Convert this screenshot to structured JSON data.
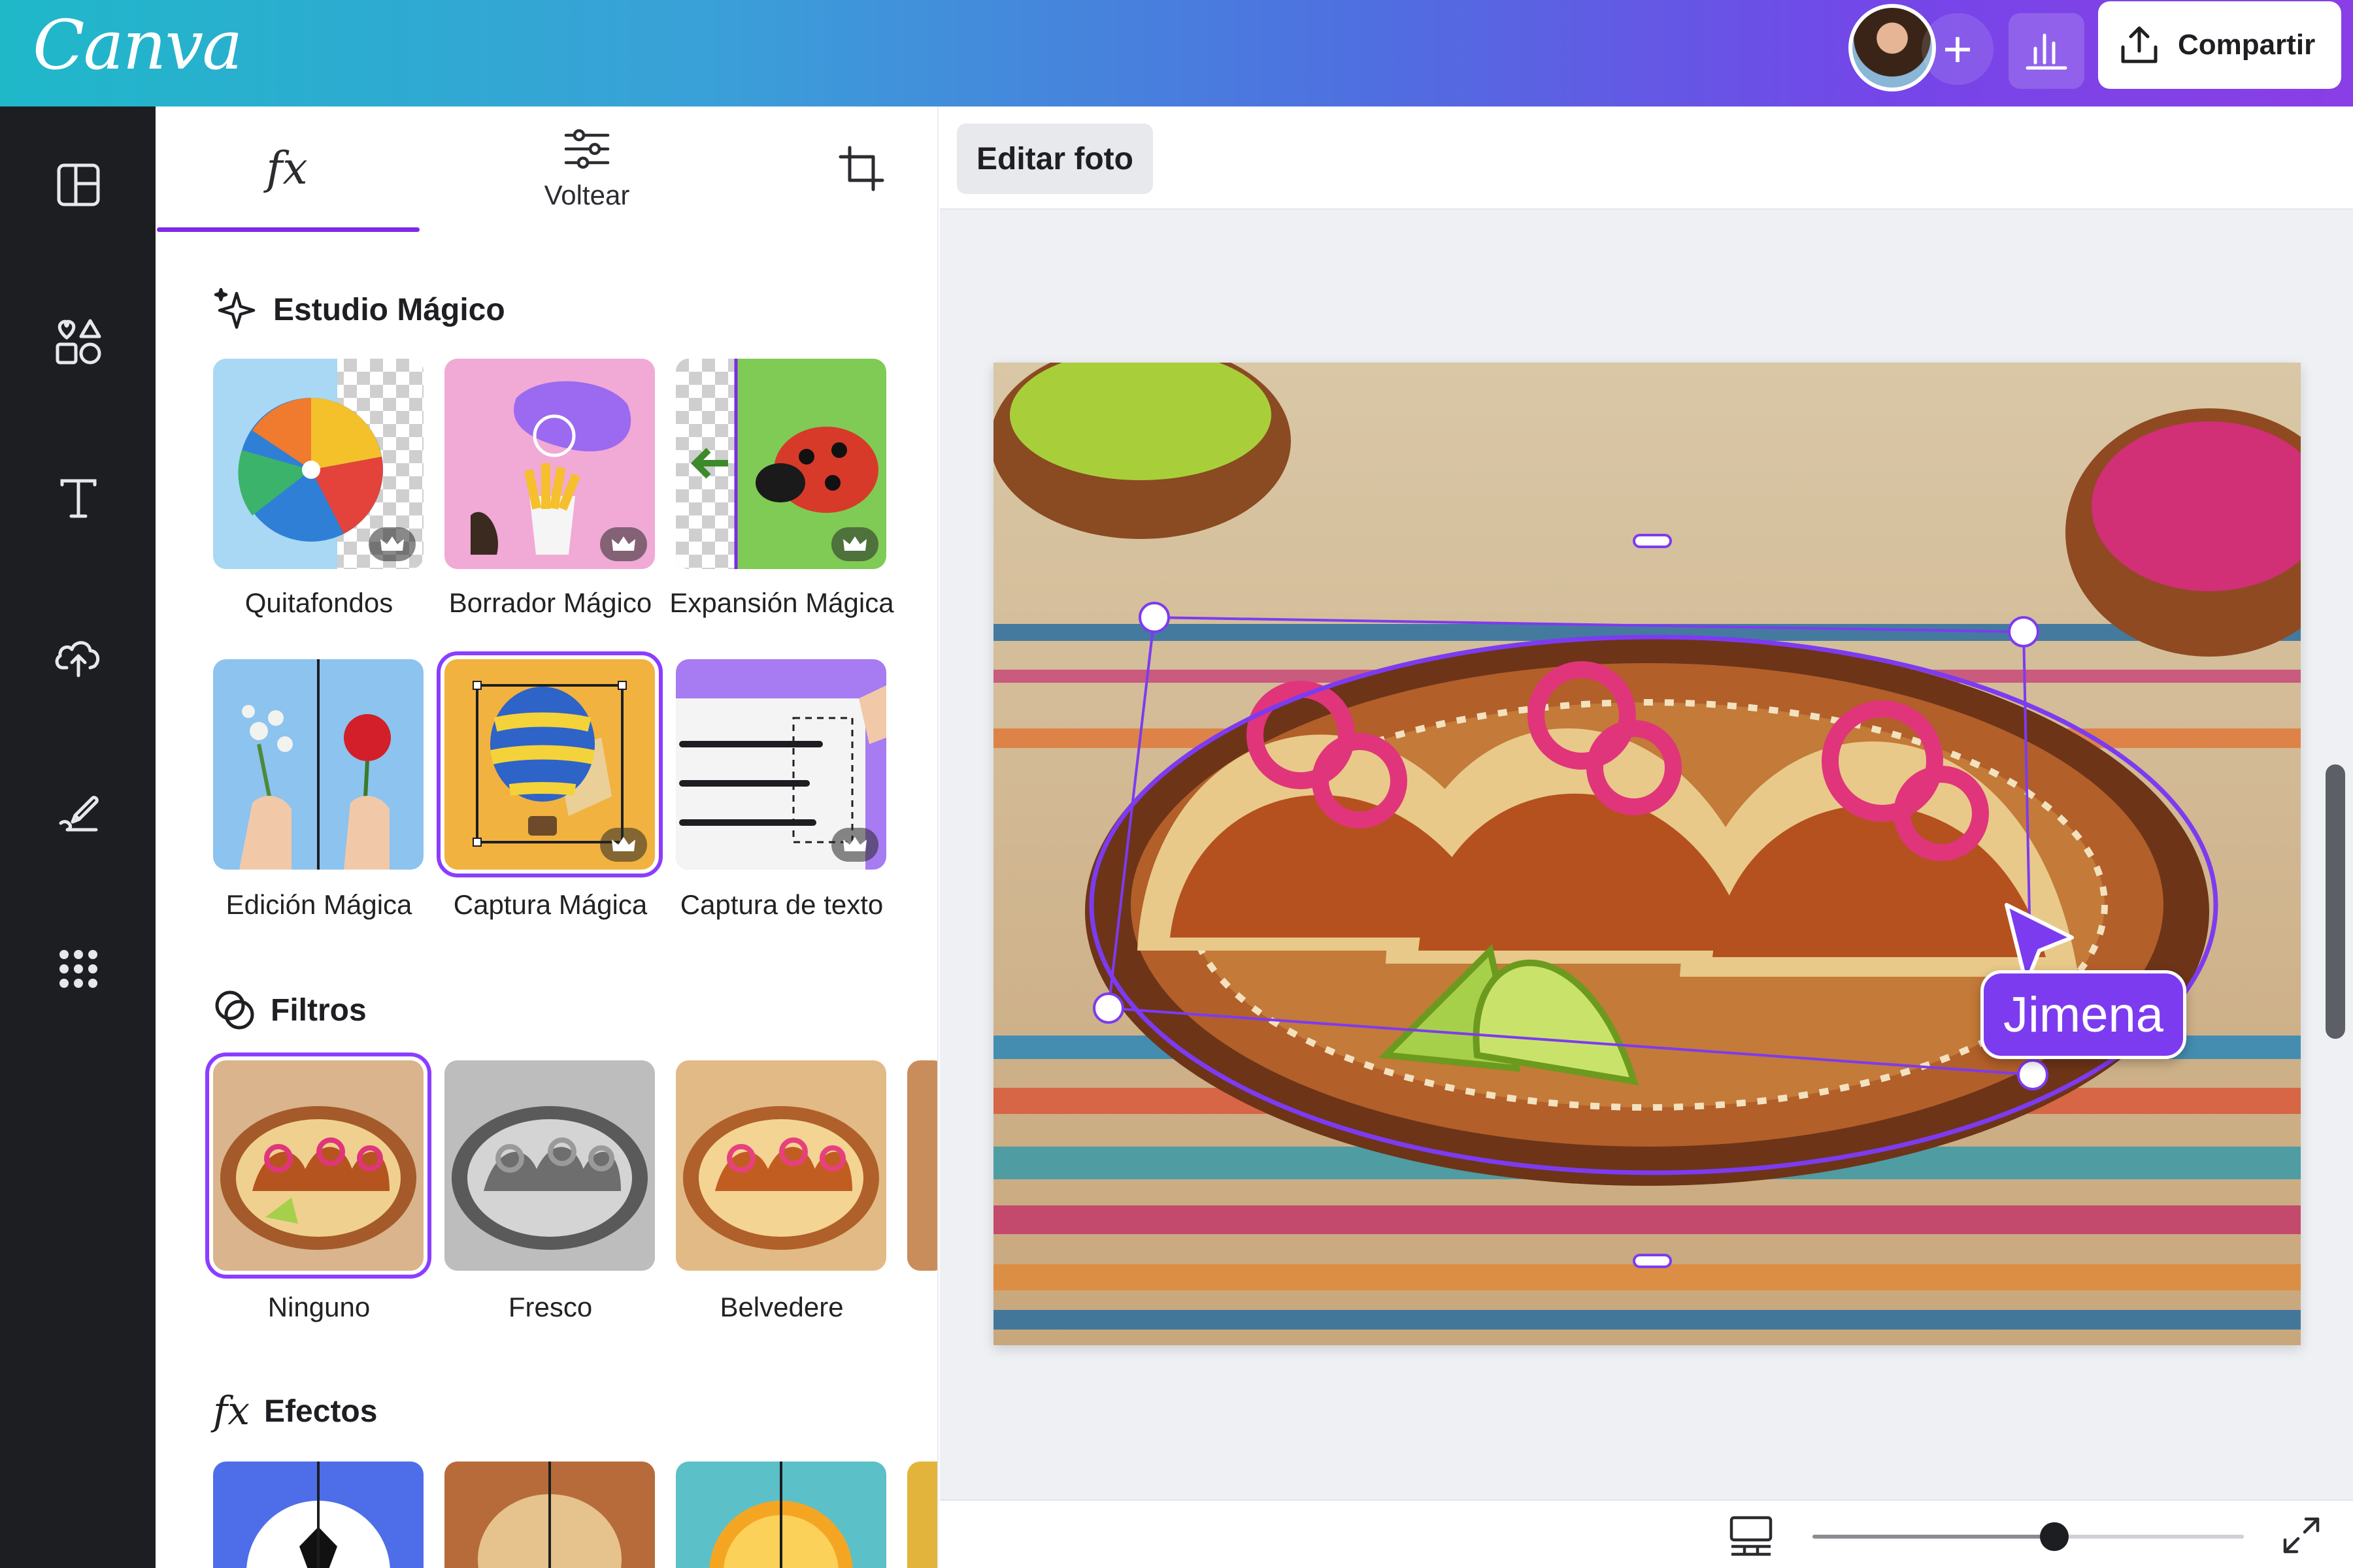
{
  "brand": {
    "logo_text": "Canva",
    "accent": "#7d2ae8"
  },
  "header": {
    "avatar_icon": "user-avatar",
    "add_icon": "plus-icon",
    "stats_icon": "bar-chart-icon",
    "share_icon": "upload-icon",
    "share_label": "Compartir"
  },
  "rail": {
    "icons": [
      "layout-icon",
      "shapes-icon",
      "text-icon",
      "upload-cloud-icon",
      "draw-icon",
      "apps-grid-icon"
    ]
  },
  "panel": {
    "tabs": [
      {
        "icon": "fx-icon",
        "label": "fx",
        "active": true
      },
      {
        "icon": "sliders-icon",
        "label": "Voltear",
        "active": false
      },
      {
        "icon": "crop-icon",
        "label": "",
        "active": false
      }
    ],
    "magic_studio": {
      "title": "Estudio Mágico",
      "items": [
        {
          "label": "Quitafondos",
          "premium": true
        },
        {
          "label": "Borrador Mágico",
          "premium": true
        },
        {
          "label": "Expansión Mágica",
          "premium": true
        },
        {
          "label": "Edición Mágica",
          "premium": false
        },
        {
          "label": "Captura Mágica",
          "premium": true,
          "selected": true
        },
        {
          "label": "Captura de texto",
          "premium": true
        }
      ]
    },
    "filters": {
      "title": "Filtros",
      "items": [
        {
          "label": "Ninguno",
          "selected": true
        },
        {
          "label": "Fresco",
          "selected": false
        },
        {
          "label": "Belvedere",
          "selected": false
        }
      ]
    },
    "effects": {
      "title": "Efectos"
    }
  },
  "canvas": {
    "edit_photo_label": "Editar foto",
    "collaborator_name": "Jimena"
  },
  "footer": {
    "pages_icon": "pages-icon",
    "zoom_fraction": 0.56,
    "fullscreen_icon": "expand-icon"
  }
}
